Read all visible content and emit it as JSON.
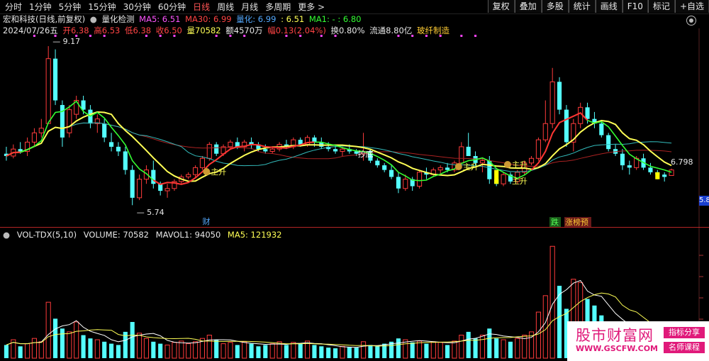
{
  "top_tabs": [
    "分时",
    "1分钟",
    "5分钟",
    "15分钟",
    "30分钟",
    "60分钟",
    "日线",
    "周线",
    "月线",
    "多周期",
    "更多 >"
  ],
  "active_tab": "日线",
  "right_buttons": [
    "复权",
    "叠加",
    "多股",
    "统计",
    "画线",
    "F10",
    "标记",
    "+自选"
  ],
  "info": {
    "stock": "宏和科技(日线,前复权)",
    "indicator": "量化检测",
    "ma5": "MA5: 6.51",
    "ma30": "MA30: 6.99",
    "lh": "量化: 6.99",
    "ma1": ": 6.51",
    "ma1b": "MA1: - : 6.80",
    "date": "2024/07/26五",
    "open": "开6.38",
    "high": "高6.53",
    "low": "低6.38",
    "close": "收6.50",
    "vol": "量70582",
    "amount": "额4570万",
    "range": "幅0.13(2.04%)",
    "turnover": "换0.80%",
    "float": "流通8.80亿",
    "sector": "玻纤制造"
  },
  "annotations": {
    "high_label": "9.17",
    "low_label": "5.74",
    "last_label": "6.798",
    "right_price": "5.8",
    "signal_label": "主升",
    "cai": "财",
    "die": "跌",
    "zhang": "涨榜预",
    "chaodi": "抄底"
  },
  "volume": {
    "legend_name": "VOL-TDX(5,10)",
    "volume": "VOLUME: 70582",
    "mavol1": "MAVOL1: 94050",
    "ma5": "MA5: 121932"
  },
  "colors": {
    "up": "#ff3b3b",
    "down": "#54ffff",
    "ma_white": "#ffffff",
    "ma_yellow": "#ffff55",
    "ma_green": "#33ff33",
    "ma_red": "#ff3333",
    "ma_cyan": "#33bbbb",
    "magenta": "#ff44ff"
  },
  "watermark": {
    "title": "股市财富网",
    "url": "WWW.GSCFW.COM",
    "tag1": "指标分享",
    "tag2": "名师课程"
  },
  "chart_data": {
    "type": "candlestick",
    "price_ylim": [
      5.5,
      9.4
    ],
    "candles": [
      {
        "o": 6.85,
        "h": 7.0,
        "l": 6.7,
        "c": 6.8
      },
      {
        "o": 6.8,
        "h": 7.05,
        "l": 6.75,
        "c": 6.95
      },
      {
        "o": 6.95,
        "h": 7.1,
        "l": 6.85,
        "c": 6.9
      },
      {
        "o": 6.9,
        "h": 7.2,
        "l": 6.8,
        "c": 7.1
      },
      {
        "o": 7.1,
        "h": 7.4,
        "l": 7.0,
        "c": 7.3
      },
      {
        "o": 7.3,
        "h": 7.6,
        "l": 7.2,
        "c": 7.4
      },
      {
        "o": 7.5,
        "h": 9.17,
        "l": 7.5,
        "c": 8.9
      },
      {
        "o": 8.9,
        "h": 9.1,
        "l": 7.9,
        "c": 8.0
      },
      {
        "o": 7.9,
        "h": 8.0,
        "l": 7.0,
        "c": 7.2
      },
      {
        "o": 7.3,
        "h": 7.9,
        "l": 7.2,
        "c": 7.8
      },
      {
        "o": 7.7,
        "h": 8.1,
        "l": 7.6,
        "c": 8.0
      },
      {
        "o": 8.0,
        "h": 8.1,
        "l": 7.7,
        "c": 7.8
      },
      {
        "o": 7.8,
        "h": 7.9,
        "l": 7.4,
        "c": 7.5
      },
      {
        "o": 7.5,
        "h": 7.7,
        "l": 7.3,
        "c": 7.6
      },
      {
        "o": 7.5,
        "h": 7.6,
        "l": 7.1,
        "c": 7.2
      },
      {
        "o": 7.1,
        "h": 7.3,
        "l": 6.9,
        "c": 7.0
      },
      {
        "o": 7.0,
        "h": 7.1,
        "l": 6.8,
        "c": 6.9
      },
      {
        "o": 6.9,
        "h": 7.0,
        "l": 6.4,
        "c": 6.5
      },
      {
        "o": 6.5,
        "h": 6.6,
        "l": 5.74,
        "c": 5.9
      },
      {
        "o": 5.9,
        "h": 6.4,
        "l": 5.85,
        "c": 6.3
      },
      {
        "o": 6.3,
        "h": 6.6,
        "l": 6.2,
        "c": 6.5
      },
      {
        "o": 6.5,
        "h": 6.7,
        "l": 6.1,
        "c": 6.2
      },
      {
        "o": 6.2,
        "h": 6.25,
        "l": 5.95,
        "c": 6.05
      },
      {
        "o": 6.05,
        "h": 6.2,
        "l": 5.9,
        "c": 6.1
      },
      {
        "o": 6.1,
        "h": 6.3,
        "l": 6.05,
        "c": 6.25
      },
      {
        "o": 6.25,
        "h": 6.4,
        "l": 6.2,
        "c": 6.35
      },
      {
        "o": 6.35,
        "h": 6.45,
        "l": 6.3,
        "c": 6.4
      },
      {
        "o": 6.4,
        "h": 6.6,
        "l": 6.35,
        "c": 6.55
      },
      {
        "o": 6.55,
        "h": 6.8,
        "l": 6.5,
        "c": 6.75
      },
      {
        "o": 6.75,
        "h": 7.1,
        "l": 6.7,
        "c": 7.05
      },
      {
        "o": 7.05,
        "h": 7.1,
        "l": 6.8,
        "c": 6.85
      },
      {
        "o": 6.85,
        "h": 7.05,
        "l": 6.8,
        "c": 7.0
      },
      {
        "o": 7.0,
        "h": 7.15,
        "l": 6.95,
        "c": 7.1
      },
      {
        "o": 7.1,
        "h": 7.2,
        "l": 6.95,
        "c": 7.0
      },
      {
        "o": 7.0,
        "h": 7.15,
        "l": 6.9,
        "c": 7.1
      },
      {
        "o": 7.1,
        "h": 7.2,
        "l": 6.95,
        "c": 7.05
      },
      {
        "o": 7.05,
        "h": 7.1,
        "l": 6.9,
        "c": 6.95
      },
      {
        "o": 6.95,
        "h": 7.05,
        "l": 6.85,
        "c": 6.9
      },
      {
        "o": 6.9,
        "h": 7.0,
        "l": 6.85,
        "c": 6.95
      },
      {
        "o": 6.95,
        "h": 7.1,
        "l": 6.9,
        "c": 7.05
      },
      {
        "o": 7.05,
        "h": 7.15,
        "l": 6.95,
        "c": 7.0
      },
      {
        "o": 7.0,
        "h": 7.2,
        "l": 6.95,
        "c": 7.15
      },
      {
        "o": 7.15,
        "h": 7.2,
        "l": 7.0,
        "c": 7.05
      },
      {
        "o": 7.05,
        "h": 7.25,
        "l": 7.0,
        "c": 7.2
      },
      {
        "o": 7.2,
        "h": 7.25,
        "l": 7.0,
        "c": 7.1
      },
      {
        "o": 7.1,
        "h": 7.2,
        "l": 6.95,
        "c": 7.0
      },
      {
        "o": 7.0,
        "h": 7.1,
        "l": 6.9,
        "c": 6.95
      },
      {
        "o": 6.95,
        "h": 7.05,
        "l": 6.85,
        "c": 6.9
      },
      {
        "o": 6.9,
        "h": 7.0,
        "l": 6.8,
        "c": 6.95
      },
      {
        "o": 6.95,
        "h": 7.05,
        "l": 6.85,
        "c": 6.9
      },
      {
        "o": 6.9,
        "h": 6.95,
        "l": 6.8,
        "c": 6.85
      },
      {
        "o": 6.85,
        "h": 7.3,
        "l": 6.7,
        "c": 6.9
      },
      {
        "o": 6.9,
        "h": 6.95,
        "l": 6.65,
        "c": 6.7
      },
      {
        "o": 6.7,
        "h": 6.75,
        "l": 6.55,
        "c": 6.6
      },
      {
        "o": 6.6,
        "h": 6.65,
        "l": 6.45,
        "c": 6.5
      },
      {
        "o": 6.5,
        "h": 6.6,
        "l": 6.3,
        "c": 6.35
      },
      {
        "o": 6.35,
        "h": 6.45,
        "l": 6.0,
        "c": 6.1
      },
      {
        "o": 6.1,
        "h": 6.4,
        "l": 6.05,
        "c": 6.3
      },
      {
        "o": 6.3,
        "h": 6.35,
        "l": 6.05,
        "c": 6.15
      },
      {
        "o": 6.15,
        "h": 6.5,
        "l": 6.1,
        "c": 6.45
      },
      {
        "o": 6.45,
        "h": 6.55,
        "l": 6.3,
        "c": 6.4
      },
      {
        "o": 6.4,
        "h": 6.55,
        "l": 6.35,
        "c": 6.5
      },
      {
        "o": 6.5,
        "h": 6.6,
        "l": 6.4,
        "c": 6.55
      },
      {
        "o": 6.55,
        "h": 6.65,
        "l": 6.45,
        "c": 6.5
      },
      {
        "o": 6.5,
        "h": 6.7,
        "l": 6.45,
        "c": 6.65
      },
      {
        "o": 6.65,
        "h": 7.1,
        "l": 6.6,
        "c": 7.0
      },
      {
        "o": 7.0,
        "h": 7.3,
        "l": 6.9,
        "c": 6.8
      },
      {
        "o": 6.8,
        "h": 6.9,
        "l": 6.6,
        "c": 6.65
      },
      {
        "o": 6.65,
        "h": 6.75,
        "l": 6.45,
        "c": 6.7
      },
      {
        "o": 6.7,
        "h": 6.8,
        "l": 6.2,
        "c": 6.3
      },
      {
        "o": 6.3,
        "h": 6.4,
        "l": 6.15,
        "c": 6.2
      },
      {
        "o": 6.2,
        "h": 6.45,
        "l": 6.15,
        "c": 6.4
      },
      {
        "o": 6.4,
        "h": 6.45,
        "l": 6.2,
        "c": 6.25
      },
      {
        "o": 6.25,
        "h": 6.5,
        "l": 6.2,
        "c": 6.45
      },
      {
        "o": 6.45,
        "h": 6.7,
        "l": 6.4,
        "c": 6.65
      },
      {
        "o": 6.65,
        "h": 6.8,
        "l": 6.6,
        "c": 6.75
      },
      {
        "o": 6.75,
        "h": 7.2,
        "l": 6.7,
        "c": 7.15
      },
      {
        "o": 7.15,
        "h": 8.0,
        "l": 7.1,
        "c": 7.5
      },
      {
        "o": 7.5,
        "h": 8.7,
        "l": 7.4,
        "c": 8.4
      },
      {
        "o": 8.4,
        "h": 8.5,
        "l": 7.7,
        "c": 7.8
      },
      {
        "o": 7.8,
        "h": 7.9,
        "l": 7.0,
        "c": 7.1
      },
      {
        "o": 7.1,
        "h": 7.6,
        "l": 6.9,
        "c": 7.5
      },
      {
        "o": 7.5,
        "h": 7.95,
        "l": 7.4,
        "c": 7.85
      },
      {
        "o": 7.85,
        "h": 7.95,
        "l": 7.5,
        "c": 7.6
      },
      {
        "o": 7.6,
        "h": 7.75,
        "l": 7.4,
        "c": 7.5
      },
      {
        "o": 7.5,
        "h": 7.55,
        "l": 7.2,
        "c": 7.25
      },
      {
        "o": 7.25,
        "h": 7.3,
        "l": 6.9,
        "c": 6.95
      },
      {
        "o": 6.95,
        "h": 7.05,
        "l": 6.8,
        "c": 6.85
      },
      {
        "o": 6.85,
        "h": 6.95,
        "l": 6.5,
        "c": 6.6
      },
      {
        "o": 6.6,
        "h": 6.7,
        "l": 6.4,
        "c": 6.55
      },
      {
        "o": 6.55,
        "h": 6.8,
        "l": 6.5,
        "c": 6.75
      },
      {
        "o": 6.75,
        "h": 6.85,
        "l": 6.5,
        "c": 6.55
      },
      {
        "o": 6.55,
        "h": 6.65,
        "l": 6.4,
        "c": 6.45
      },
      {
        "o": 6.45,
        "h": 6.5,
        "l": 6.3,
        "c": 6.4
      },
      {
        "o": 6.4,
        "h": 6.45,
        "l": 6.25,
        "c": 6.35
      },
      {
        "o": 6.38,
        "h": 6.53,
        "l": 6.38,
        "c": 6.5
      }
    ],
    "volumes": [
      20,
      28,
      18,
      22,
      30,
      25,
      85,
      60,
      45,
      40,
      55,
      35,
      30,
      28,
      25,
      22,
      20,
      40,
      55,
      38,
      30,
      25,
      22,
      20,
      24,
      26,
      22,
      25,
      30,
      35,
      28,
      22,
      24,
      20,
      25,
      22,
      18,
      20,
      22,
      25,
      20,
      24,
      22,
      26,
      20,
      18,
      16,
      15,
      18,
      17,
      16,
      25,
      20,
      18,
      22,
      25,
      30,
      28,
      24,
      26,
      22,
      25,
      24,
      20,
      26,
      35,
      40,
      30,
      35,
      45,
      30,
      28,
      25,
      30,
      35,
      40,
      70,
      95,
      170,
      110,
      75,
      120,
      115,
      90,
      80,
      65,
      55,
      50,
      45,
      40,
      42,
      38,
      35,
      30,
      28,
      25
    ]
  }
}
